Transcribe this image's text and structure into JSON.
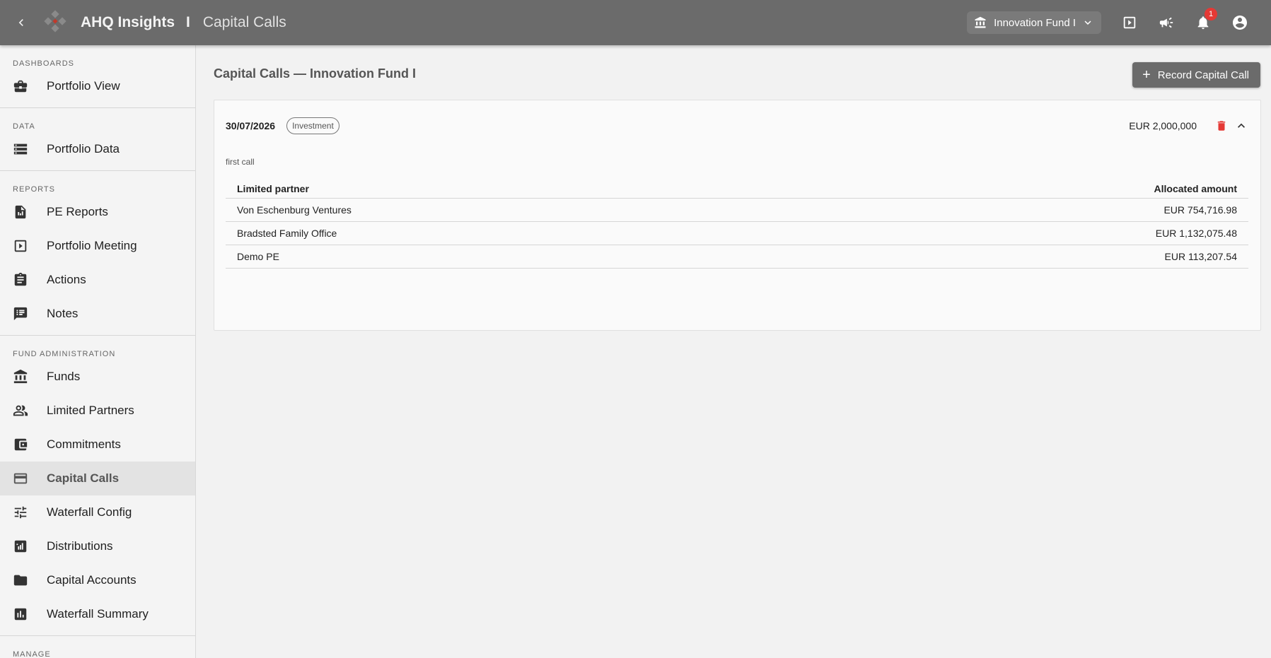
{
  "header": {
    "app_title": "AHQ Insights",
    "separator": "I",
    "page_crumb": "Capital Calls",
    "fund_selector": {
      "value": "Innovation Fund I"
    },
    "notifications_count": "1"
  },
  "sidebar": {
    "sections": [
      {
        "label": "DASHBOARDS",
        "items": [
          {
            "label": "Portfolio View",
            "icon": "briefcase-icon"
          }
        ]
      },
      {
        "label": "DATA",
        "items": [
          {
            "label": "Portfolio Data",
            "icon": "storage-icon"
          }
        ]
      },
      {
        "label": "REPORTS",
        "items": [
          {
            "label": "PE Reports",
            "icon": "report-icon"
          },
          {
            "label": "Portfolio Meeting",
            "icon": "slideshow-icon"
          },
          {
            "label": "Actions",
            "icon": "clipboard-icon"
          },
          {
            "label": "Notes",
            "icon": "notes-icon"
          }
        ]
      },
      {
        "label": "FUND ADMINISTRATION",
        "items": [
          {
            "label": "Funds",
            "icon": "bank-icon"
          },
          {
            "label": "Limited Partners",
            "icon": "people-icon"
          },
          {
            "label": "Commitments",
            "icon": "wallet-icon"
          },
          {
            "label": "Capital Calls",
            "icon": "credit-card-icon",
            "active": true
          },
          {
            "label": "Waterfall Config",
            "icon": "tune-icon"
          },
          {
            "label": "Distributions",
            "icon": "bar-chart-icon"
          },
          {
            "label": "Capital Accounts",
            "icon": "folder-icon"
          },
          {
            "label": "Waterfall Summary",
            "icon": "analytics-icon"
          }
        ]
      },
      {
        "label": "MANAGE",
        "items": []
      }
    ]
  },
  "main": {
    "heading": "Capital Calls — Innovation Fund I",
    "record_button": "Record Capital Call",
    "call": {
      "date": "30/07/2026",
      "type": "Investment",
      "amount": "EUR 2,000,000",
      "note": "first call",
      "columns": [
        "Limited partner",
        "Allocated amount"
      ],
      "rows": [
        {
          "partner": "Von Eschenburg Ventures",
          "amount": "EUR 754,716.98"
        },
        {
          "partner": "Bradsted Family Office",
          "amount": "EUR 1,132,075.48"
        },
        {
          "partner": "Demo PE",
          "amount": "EUR 113,207.54"
        }
      ]
    }
  },
  "colors": {
    "topbar": "#6b6b6b",
    "delete": "#e53935",
    "active_nav": "#e3e3e3"
  }
}
